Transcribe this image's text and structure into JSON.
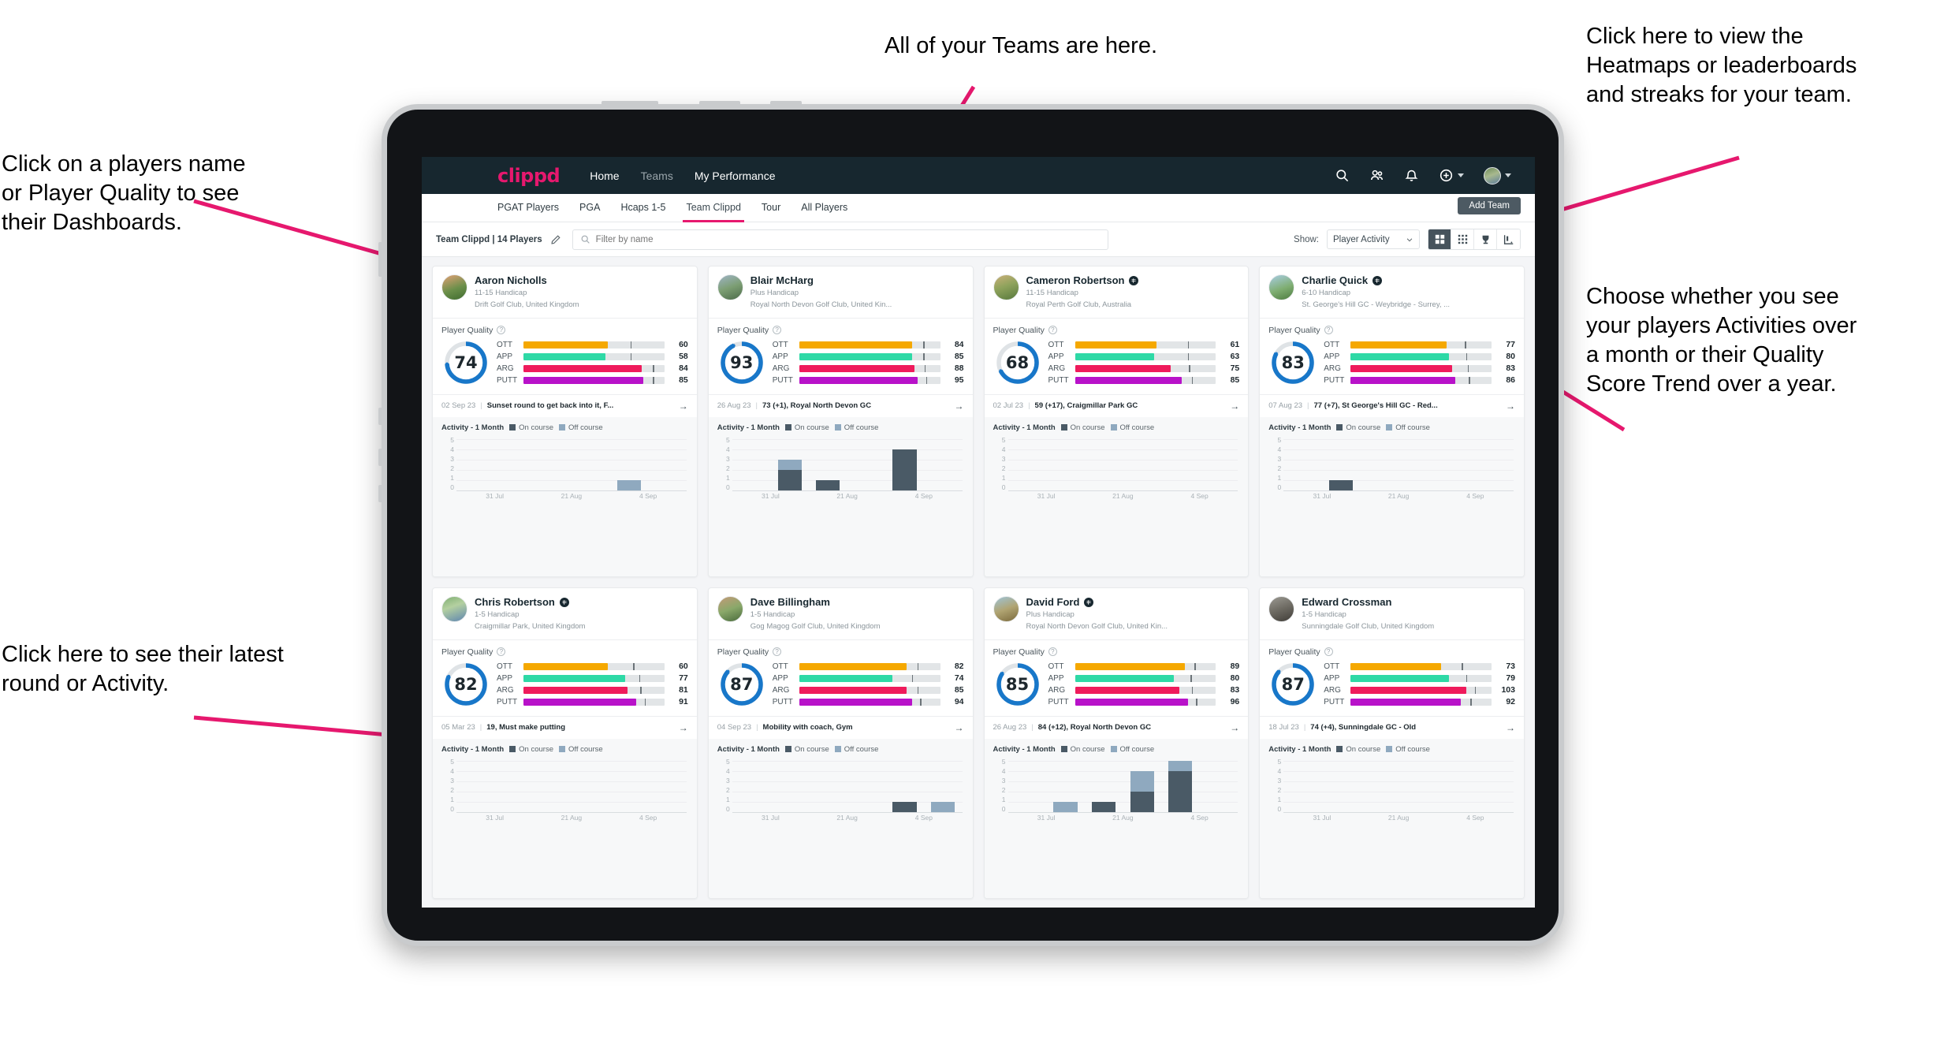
{
  "annotations": [
    {
      "id": "players-name",
      "text": "Click on a players name\nor Player Quality to see\ntheir Dashboards."
    },
    {
      "id": "teams",
      "text": "All of your Teams are here."
    },
    {
      "id": "heatmaps",
      "text": "Click here to view the\nHeatmaps or leaderboards\nand streaks for your team."
    },
    {
      "id": "activity-toggle",
      "text": "Choose whether you see\nyour players Activities over\na month or their Quality\nScore Trend over a year."
    },
    {
      "id": "latest-round",
      "text": "Click here to see their latest\nround or Activity."
    }
  ],
  "annotation_color": "#e6186e",
  "app": {
    "brand": "clippd",
    "nav_links": [
      {
        "label": "Home",
        "active": true
      },
      {
        "label": "Teams",
        "active": false
      },
      {
        "label": "My Performance",
        "active": true
      }
    ],
    "nav_icons": [
      "search-icon",
      "people-icon",
      "bell-icon",
      "plus-circle-icon",
      "avatar"
    ],
    "subtabs": [
      {
        "label": "PGAT Players",
        "active": false
      },
      {
        "label": "PGA",
        "active": false
      },
      {
        "label": "Hcaps 1-5",
        "active": false
      },
      {
        "label": "Team Clippd",
        "active": true
      },
      {
        "label": "Tour",
        "active": false
      },
      {
        "label": "All Players",
        "active": false
      }
    ],
    "add_team_label": "Add Team",
    "toolbar": {
      "team_label": "Team Clippd | 14 Players",
      "edit_icon": "pencil-icon",
      "search_placeholder": "Filter by name",
      "search_value": "",
      "show_label": "Show:",
      "show_value": "Player Activity",
      "view_modes": [
        {
          "icon": "grid-large-icon",
          "active": true
        },
        {
          "icon": "grid-small-icon",
          "active": false
        },
        {
          "icon": "trophy-icon",
          "active": false
        },
        {
          "icon": "streak-icon",
          "active": false
        }
      ]
    }
  },
  "card_labels": {
    "player_quality": "Player Quality",
    "help_icon": "question-icon",
    "activity_title": "Activity - 1 Month",
    "legend_on": "On course",
    "legend_off": "Off course",
    "arrow": "→"
  },
  "metric_colors": {
    "OTT": "#f5a800",
    "APP": "#2ed9a6",
    "ARG": "#ef1b5c",
    "PUTT": "#b812c9",
    "donut": "#1877c9",
    "donut_track": "#dfe3e6"
  },
  "chart_axis": {
    "yticks": [
      "5",
      "4",
      "3",
      "2",
      "1",
      "0"
    ],
    "ymax": 5,
    "xticks": [
      "31 Jul",
      "21 Aug",
      "4 Sep"
    ]
  },
  "players": [
    {
      "name": "Aaron Nicholls",
      "verified": false,
      "handicap": "11-15 Handicap",
      "club": "Drift Golf Club, United Kingdom",
      "avatar": "linear-gradient(160deg,#e2a176 0%,#6b8f4a 55%,#3f6b2f 100%)",
      "quality": 74,
      "metrics": [
        {
          "label": "OTT",
          "value": 60,
          "fill": 60,
          "tick": 76
        },
        {
          "label": "APP",
          "value": 58,
          "fill": 58,
          "tick": 76
        },
        {
          "label": "ARG",
          "value": 84,
          "fill": 84,
          "tick": 92
        },
        {
          "label": "PUTT",
          "value": 85,
          "fill": 85,
          "tick": 92
        }
      ],
      "round": {
        "date": "02 Sep 23",
        "text": "Sunset round to get back into it, F..."
      },
      "chart_data": {
        "type": "bar",
        "title": "Activity - 1 Month",
        "categories": [
          "31 Jul",
          "21 Aug",
          "4 Sep"
        ],
        "ylim": [
          0,
          5
        ],
        "bars": [
          {
            "slot": 0,
            "on": 0,
            "off": 0
          },
          {
            "slot": 1,
            "on": 0,
            "off": 0
          },
          {
            "slot": 2,
            "on": 0,
            "off": 0
          },
          {
            "slot": 3,
            "on": 0,
            "off": 0
          },
          {
            "slot": 4,
            "on": 0,
            "off": 1
          },
          {
            "slot": 5,
            "on": 0,
            "off": 0
          }
        ]
      }
    },
    {
      "name": "Blair McHarg",
      "verified": false,
      "handicap": "Plus Handicap",
      "club": "Royal North Devon Golf Club, United Kin...",
      "avatar": "linear-gradient(160deg,#9fb4c6 0%,#7c9e73 50%,#4c6b4a 100%)",
      "quality": 93,
      "metrics": [
        {
          "label": "OTT",
          "value": 84,
          "fill": 80,
          "tick": 88
        },
        {
          "label": "APP",
          "value": 85,
          "fill": 80,
          "tick": 88
        },
        {
          "label": "ARG",
          "value": 88,
          "fill": 82,
          "tick": 89
        },
        {
          "label": "PUTT",
          "value": 95,
          "fill": 84,
          "tick": 90
        }
      ],
      "round": {
        "date": "26 Aug 23",
        "text": "73 (+1), Royal North Devon GC"
      },
      "chart_data": {
        "type": "bar",
        "title": "Activity - 1 Month",
        "categories": [
          "31 Jul",
          "21 Aug",
          "4 Sep"
        ],
        "ylim": [
          0,
          5
        ],
        "bars": [
          {
            "slot": 0,
            "on": 0,
            "off": 0
          },
          {
            "slot": 1,
            "on": 2,
            "off": 1
          },
          {
            "slot": 2,
            "on": 1,
            "off": 0
          },
          {
            "slot": 3,
            "on": 0,
            "off": 0
          },
          {
            "slot": 4,
            "on": 4,
            "off": 0
          },
          {
            "slot": 5,
            "on": 0,
            "off": 0
          }
        ]
      }
    },
    {
      "name": "Cameron Robertson",
      "verified": true,
      "handicap": "11-15 Handicap",
      "club": "Royal Perth Golf Club, Australia",
      "avatar": "linear-gradient(160deg,#cbb07a 0%,#8fa35c 45%,#57783d 100%)",
      "quality": 68,
      "metrics": [
        {
          "label": "OTT",
          "value": 61,
          "fill": 58,
          "tick": 80
        },
        {
          "label": "APP",
          "value": 63,
          "fill": 56,
          "tick": 80
        },
        {
          "label": "ARG",
          "value": 75,
          "fill": 68,
          "tick": 81
        },
        {
          "label": "PUTT",
          "value": 85,
          "fill": 76,
          "tick": 83
        }
      ],
      "round": {
        "date": "02 Jul 23",
        "text": "59 (+17), Craigmillar Park GC"
      },
      "chart_data": {
        "type": "bar",
        "title": "Activity - 1 Month",
        "categories": [
          "31 Jul",
          "21 Aug",
          "4 Sep"
        ],
        "ylim": [
          0,
          5
        ],
        "bars": [
          {
            "slot": 0,
            "on": 0,
            "off": 0
          },
          {
            "slot": 1,
            "on": 0,
            "off": 0
          },
          {
            "slot": 2,
            "on": 0,
            "off": 0
          },
          {
            "slot": 3,
            "on": 0,
            "off": 0
          },
          {
            "slot": 4,
            "on": 0,
            "off": 0
          },
          {
            "slot": 5,
            "on": 0,
            "off": 0
          }
        ]
      }
    },
    {
      "name": "Charlie Quick",
      "verified": true,
      "handicap": "6-10 Handicap",
      "club": "St. George's Hill GC - Weybridge - Surrey, ...",
      "avatar": "linear-gradient(160deg,#a9cde4 0%,#7fae72 55%,#4d7b3f 100%)",
      "quality": 83,
      "metrics": [
        {
          "label": "OTT",
          "value": 77,
          "fill": 68,
          "tick": 81
        },
        {
          "label": "APP",
          "value": 80,
          "fill": 70,
          "tick": 82
        },
        {
          "label": "ARG",
          "value": 83,
          "fill": 72,
          "tick": 83
        },
        {
          "label": "PUTT",
          "value": 86,
          "fill": 74,
          "tick": 84
        }
      ],
      "round": {
        "date": "07 Aug 23",
        "text": "77 (+7), St George's Hill GC - Red..."
      },
      "chart_data": {
        "type": "bar",
        "title": "Activity - 1 Month",
        "categories": [
          "31 Jul",
          "21 Aug",
          "4 Sep"
        ],
        "ylim": [
          0,
          5
        ],
        "bars": [
          {
            "slot": 0,
            "on": 0,
            "off": 0
          },
          {
            "slot": 1,
            "on": 1,
            "off": 0
          },
          {
            "slot": 2,
            "on": 0,
            "off": 0
          },
          {
            "slot": 3,
            "on": 0,
            "off": 0
          },
          {
            "slot": 4,
            "on": 0,
            "off": 0
          },
          {
            "slot": 5,
            "on": 0,
            "off": 0
          }
        ]
      }
    },
    {
      "name": "Chris Robertson",
      "verified": true,
      "handicap": "1-5 Handicap",
      "club": "Craigmillar Park, United Kingdom",
      "avatar": "linear-gradient(160deg,#7fae72 0%,#b4d0a0 40%,#5f86b0 100%)",
      "quality": 82,
      "metrics": [
        {
          "label": "OTT",
          "value": 60,
          "fill": 60,
          "tick": 78
        },
        {
          "label": "APP",
          "value": 77,
          "fill": 72,
          "tick": 82
        },
        {
          "label": "ARG",
          "value": 81,
          "fill": 74,
          "tick": 83
        },
        {
          "label": "PUTT",
          "value": 91,
          "fill": 80,
          "tick": 86
        }
      ],
      "round": {
        "date": "05 Mar 23",
        "text": "19, Must make putting"
      },
      "chart_data": {
        "type": "bar",
        "title": "Activity - 1 Month",
        "categories": [
          "31 Jul",
          "21 Aug",
          "4 Sep"
        ],
        "ylim": [
          0,
          5
        ],
        "bars": [
          {
            "slot": 0,
            "on": 0,
            "off": 0
          },
          {
            "slot": 1,
            "on": 0,
            "off": 0
          },
          {
            "slot": 2,
            "on": 0,
            "off": 0
          },
          {
            "slot": 3,
            "on": 0,
            "off": 0
          },
          {
            "slot": 4,
            "on": 0,
            "off": 0
          },
          {
            "slot": 5,
            "on": 0,
            "off": 0
          }
        ]
      }
    },
    {
      "name": "Dave Billingham",
      "verified": false,
      "handicap": "1-5 Handicap",
      "club": "Gog Magog Golf Club, United Kingdom",
      "avatar": "linear-gradient(160deg,#c49a78 0%,#8aa86a 50%,#4a6b3c 100%)",
      "quality": 87,
      "metrics": [
        {
          "label": "OTT",
          "value": 82,
          "fill": 76,
          "tick": 84
        },
        {
          "label": "APP",
          "value": 74,
          "fill": 66,
          "tick": 80
        },
        {
          "label": "ARG",
          "value": 85,
          "fill": 76,
          "tick": 84
        },
        {
          "label": "PUTT",
          "value": 94,
          "fill": 80,
          "tick": 86
        }
      ],
      "round": {
        "date": "04 Sep 23",
        "text": "Mobility with coach, Gym"
      },
      "chart_data": {
        "type": "bar",
        "title": "Activity - 1 Month",
        "categories": [
          "31 Jul",
          "21 Aug",
          "4 Sep"
        ],
        "ylim": [
          0,
          5
        ],
        "bars": [
          {
            "slot": 0,
            "on": 0,
            "off": 0
          },
          {
            "slot": 1,
            "on": 0,
            "off": 0
          },
          {
            "slot": 2,
            "on": 0,
            "off": 0
          },
          {
            "slot": 3,
            "on": 0,
            "off": 0
          },
          {
            "slot": 4,
            "on": 1,
            "off": 0
          },
          {
            "slot": 5,
            "on": 0,
            "off": 1
          }
        ]
      }
    },
    {
      "name": "David Ford",
      "verified": true,
      "handicap": "Plus Handicap",
      "club": "Royal North Devon Golf Club, United Kin...",
      "avatar": "linear-gradient(160deg,#9ec4d8 0%,#b0a472 50%,#7b6a3c 100%)",
      "quality": 85,
      "metrics": [
        {
          "label": "OTT",
          "value": 89,
          "fill": 78,
          "tick": 85
        },
        {
          "label": "APP",
          "value": 80,
          "fill": 70,
          "tick": 82
        },
        {
          "label": "ARG",
          "value": 83,
          "fill": 74,
          "tick": 83
        },
        {
          "label": "PUTT",
          "value": 96,
          "fill": 80,
          "tick": 86
        }
      ],
      "round": {
        "date": "26 Aug 23",
        "text": "84 (+12), Royal North Devon GC"
      },
      "chart_data": {
        "type": "bar",
        "title": "Activity - 1 Month",
        "categories": [
          "31 Jul",
          "21 Aug",
          "4 Sep"
        ],
        "ylim": [
          0,
          5
        ],
        "bars": [
          {
            "slot": 0,
            "on": 0,
            "off": 0
          },
          {
            "slot": 1,
            "on": 0,
            "off": 1
          },
          {
            "slot": 2,
            "on": 1,
            "off": 0
          },
          {
            "slot": 3,
            "on": 2,
            "off": 2
          },
          {
            "slot": 4,
            "on": 4,
            "off": 1
          },
          {
            "slot": 5,
            "on": 0,
            "off": 0
          }
        ]
      }
    },
    {
      "name": "Edward Crossman",
      "verified": false,
      "handicap": "1-5 Handicap",
      "club": "Sunningdale Golf Club, United Kingdom",
      "avatar": "linear-gradient(160deg,#9c9a93 0%,#6d6a62 50%,#403d38 100%)",
      "quality": 87,
      "metrics": [
        {
          "label": "OTT",
          "value": 73,
          "fill": 64,
          "tick": 79
        },
        {
          "label": "APP",
          "value": 79,
          "fill": 70,
          "tick": 82
        },
        {
          "label": "ARG",
          "value": 103,
          "fill": 82,
          "tick": 88
        },
        {
          "label": "PUTT",
          "value": 92,
          "fill": 78,
          "tick": 85
        }
      ],
      "round": {
        "date": "18 Jul 23",
        "text": "74 (+4), Sunningdale GC - Old"
      },
      "chart_data": {
        "type": "bar",
        "title": "Activity - 1 Month",
        "categories": [
          "31 Jul",
          "21 Aug",
          "4 Sep"
        ],
        "ylim": [
          0,
          5
        ],
        "bars": [
          {
            "slot": 0,
            "on": 0,
            "off": 0
          },
          {
            "slot": 1,
            "on": 0,
            "off": 0
          },
          {
            "slot": 2,
            "on": 0,
            "off": 0
          },
          {
            "slot": 3,
            "on": 0,
            "off": 0
          },
          {
            "slot": 4,
            "on": 0,
            "off": 0
          },
          {
            "slot": 5,
            "on": 0,
            "off": 0
          }
        ]
      }
    }
  ]
}
